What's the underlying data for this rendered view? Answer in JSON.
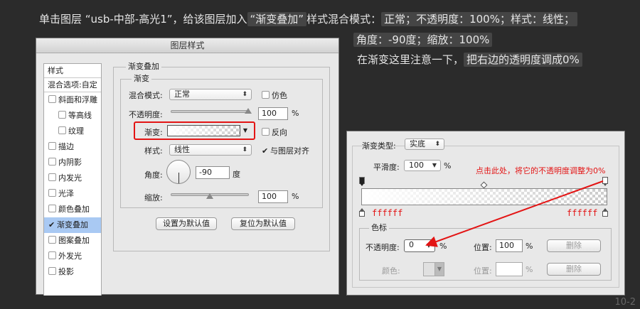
{
  "instructions": {
    "line1_prefix": "单击图层 “usb-中部-高光1”，给该图层加入",
    "line1_hl1": "“渐变叠加”",
    "line1_mid": "样式混合模式：",
    "line1_hl2": "正常；不透明度：100%；样式：线性；",
    "line2_hl": "角度：-90度；缩放：100%",
    "line3_prefix": "在渐变这里注意一下，",
    "line3_hl": "把右边的透明度调成0%"
  },
  "dialog": {
    "title": "图层样式",
    "left_panel": {
      "header": "样式",
      "blend_options": "混合选项:自定",
      "items": [
        {
          "label": "斜面和浮雕",
          "checked": false,
          "indent": false
        },
        {
          "label": "等高线",
          "checked": false,
          "indent": true
        },
        {
          "label": "纹理",
          "checked": false,
          "indent": true
        },
        {
          "label": "描边",
          "checked": false,
          "indent": false
        },
        {
          "label": "内阴影",
          "checked": false,
          "indent": false
        },
        {
          "label": "内发光",
          "checked": false,
          "indent": false
        },
        {
          "label": "光泽",
          "checked": false,
          "indent": false
        },
        {
          "label": "颜色叠加",
          "checked": false,
          "indent": false
        },
        {
          "label": "渐变叠加",
          "checked": true,
          "indent": false
        },
        {
          "label": "图案叠加",
          "checked": false,
          "indent": false
        },
        {
          "label": "外发光",
          "checked": false,
          "indent": false
        },
        {
          "label": "投影",
          "checked": false,
          "indent": false
        }
      ]
    },
    "gradient_overlay": {
      "group_title": "渐变叠加",
      "sub_title": "渐变",
      "blend_label": "混合模式:",
      "blend_value": "正常",
      "dither_label": "仿色",
      "opacity_label": "不透明度:",
      "opacity_value": "100",
      "opacity_unit": "%",
      "opacity_level": 1.0,
      "gradient_label": "渐变:",
      "reverse_label": "反向",
      "style_label": "样式:",
      "style_value": "线性",
      "align_label": "与图层对齐",
      "align_checked": true,
      "angle_label": "角度:",
      "angle_value": "-90",
      "angle_unit": "度",
      "scale_label": "缩放:",
      "scale_value": "100",
      "scale_unit": "%",
      "scale_level": 0.5,
      "default_button": "设置为默认值",
      "reset_button": "复位为默认值"
    }
  },
  "gradient_editor": {
    "type_label": "渐变类型:",
    "type_value": "实底",
    "smooth_label": "平滑度:",
    "smooth_value": "100",
    "smooth_unit": "%",
    "annotation": "点击此处，将它的不透明度调整为0%",
    "left_color": "ffffff",
    "right_color": "ffffff",
    "stops_group": "色标",
    "stop_opacity_label": "不透明度:",
    "stop_opacity_value": "0",
    "stop_opacity_unit": "%",
    "pos_label1": "位置:",
    "pos_value1": "100",
    "pos_unit1": "%",
    "delete_label1": "删除",
    "color_label": "颜色:",
    "pos_label2": "位置:",
    "pos_unit2": "%",
    "delete_label2": "删除"
  },
  "page_tag": "10-2",
  "colors": {
    "accent_red": "#e31414",
    "highlight_blue": "#a9c9f3",
    "background": "#2b2b2b"
  }
}
